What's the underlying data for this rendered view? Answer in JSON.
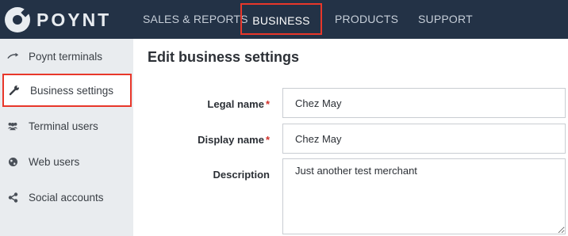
{
  "header": {
    "logo_text": "POYNT",
    "nav": [
      {
        "label": "SALES & REPORTS"
      },
      {
        "label": "BUSINESS"
      },
      {
        "label": "PRODUCTS"
      },
      {
        "label": "SUPPORT"
      }
    ],
    "active_nav": "BUSINESS"
  },
  "sidebar": {
    "items": [
      {
        "label": "Poynt terminals",
        "icon": "terminal-icon"
      },
      {
        "label": "Business settings",
        "icon": "wrench-icon"
      },
      {
        "label": "Terminal users",
        "icon": "users-icon"
      },
      {
        "label": "Web users",
        "icon": "globe-icon"
      },
      {
        "label": "Social accounts",
        "icon": "share-icon"
      }
    ],
    "active_item": "Business settings"
  },
  "main": {
    "title": "Edit business settings",
    "fields": {
      "legal_name": {
        "label": "Legal name",
        "required_mark": "*",
        "value": "Chez May"
      },
      "display_name": {
        "label": "Display name",
        "required_mark": "*",
        "value": "Chez May"
      },
      "description": {
        "label": "Description",
        "value": "Just another test merchant"
      }
    }
  },
  "colors": {
    "topbar": "#233246",
    "sidebar": "#e9ecef",
    "highlight": "#e8372a",
    "required": "#d0302a"
  }
}
